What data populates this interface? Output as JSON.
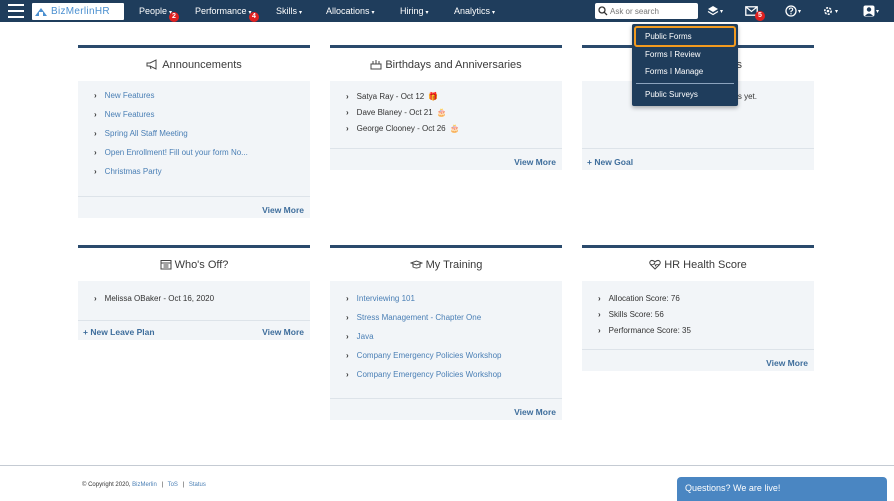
{
  "brand": {
    "name": "BizMerlinHR"
  },
  "nav": {
    "people": "People",
    "people_badge": "2",
    "performance": "Performance",
    "performance_badge": "4",
    "skills": "Skills",
    "allocations": "Allocations",
    "hiring": "Hiring",
    "analytics": "Analytics",
    "caret": "▾",
    "mail_badge": "5"
  },
  "search": {
    "placeholder": "Ask or search"
  },
  "dropdown": {
    "items": [
      "Public Forms",
      "Forms I Review",
      "Forms I Manage",
      "Public Surveys"
    ]
  },
  "cards": {
    "announcements": {
      "title": "Announcements",
      "items": [
        "New Features",
        "New Features",
        "Spring All Staff Meeting",
        "Open Enrollment! Fill out your form No...",
        "Christmas Party"
      ],
      "view_more": "View More"
    },
    "birthdays": {
      "title": "Birthdays and Anniversaries",
      "items": [
        "Satya Ray - Oct 12",
        "Dave Blaney - Oct 21",
        "George Clooney - Oct 26"
      ],
      "view_more": "View More"
    },
    "goals": {
      "title_tail": "s",
      "body_tail": "s yet.",
      "new_goal": "+ New Goal"
    },
    "whos_off": {
      "title": "Who's Off?",
      "items": [
        "Melissa OBaker - Oct 16, 2020"
      ],
      "new_leave": "+ New Leave Plan",
      "view_more": "View More"
    },
    "training": {
      "title": "My Training",
      "items": [
        "Interviewing 101",
        "Stress Management - Chapter One",
        "Java",
        "Company Emergency Policies Workshop",
        "Company Emergency Policies Workshop"
      ],
      "view_more": "View More"
    },
    "health": {
      "title": "HR Health Score",
      "items": [
        "Allocation Score: 76",
        "Skills Score: 56",
        "Performance Score: 35"
      ],
      "view_more": "View More"
    }
  },
  "footer": {
    "copyright": "© Copyright 2020,",
    "company": "BizMerlin",
    "sep": "|",
    "tos": "ToS",
    "status": "Status"
  },
  "chat": {
    "label": "Questions? We are live!"
  },
  "colors": {
    "navbar": "#1f3d5c",
    "highlight": "#f29a1f",
    "badge": "#e02020",
    "link": "#4a7fb5"
  }
}
